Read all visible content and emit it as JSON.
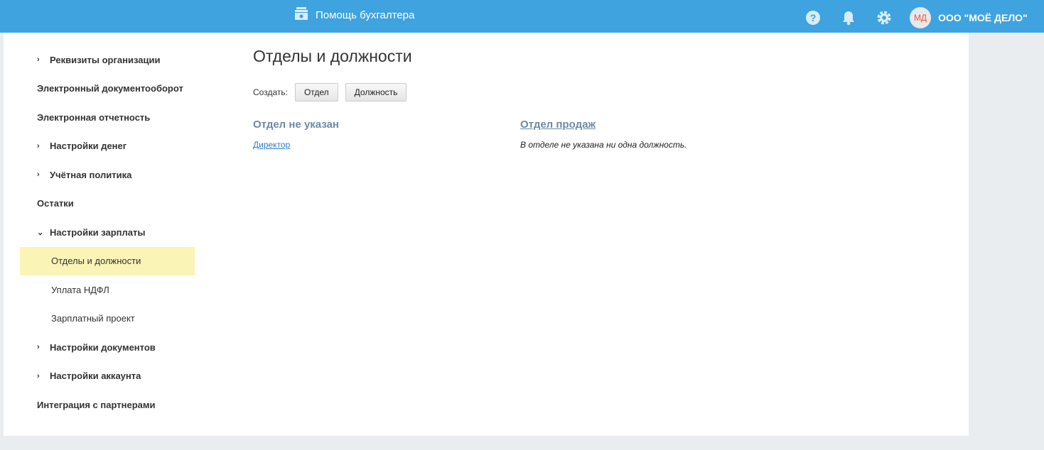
{
  "header": {
    "title": "Помощь бухгалтера",
    "avatar": "МД",
    "org": "ООО \"МОЁ ДЕЛО\""
  },
  "sidebar": {
    "items": [
      {
        "label": "Реквизиты организации",
        "chevron": "›"
      },
      {
        "label": "Электронный документооборот"
      },
      {
        "label": "Электронная отчетность"
      },
      {
        "label": "Настройки денег",
        "chevron": "›"
      },
      {
        "label": "Учётная политика",
        "chevron": "›"
      },
      {
        "label": "Остатки"
      },
      {
        "label": "Настройки зарплаты",
        "chevron": "⌄"
      },
      {
        "label": "Отделы и должности"
      },
      {
        "label": "Уплата НДФЛ"
      },
      {
        "label": "Зарплатный проект"
      },
      {
        "label": "Настройки документов",
        "chevron": "›"
      },
      {
        "label": "Настройки аккаунта",
        "chevron": "›"
      },
      {
        "label": "Интеграция с партнерами"
      }
    ]
  },
  "main": {
    "title": "Отделы и должности",
    "create_label": "Создать:",
    "btn_department": "Отдел",
    "btn_position": "Должность",
    "departments": [
      {
        "name": "Отдел не указан",
        "position": "Директор"
      },
      {
        "name": "Отдел продаж",
        "empty": "В отделе не указана ни одна должность."
      }
    ]
  }
}
